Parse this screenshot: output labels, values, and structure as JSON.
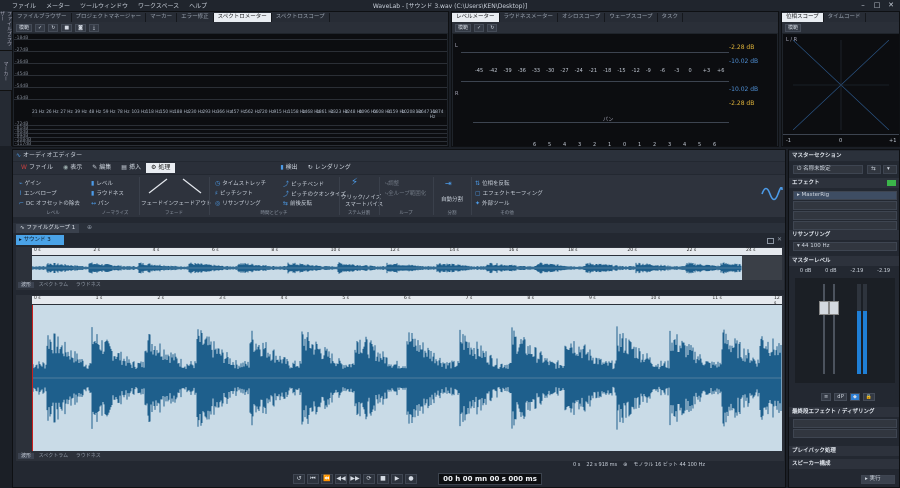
{
  "menubar": {
    "items": [
      "ファイル",
      "メーター",
      "ツールウィンドウ",
      "ワークスペース",
      "ヘルプ"
    ],
    "title": "WaveLab - [サウンド 3.wav (C:\\Users\\KEN\\Desktop)]",
    "controls": [
      "–",
      "□",
      "✕"
    ]
  },
  "left_tabs": [
    "ファイルブラウザー",
    "マーカー"
  ],
  "top_tabs": [
    "ファイルブラウザー",
    "プロジェクトマネージャー",
    "マーカー",
    "エラー修正",
    "スペクトロメーター",
    "スペクトロスコープ"
  ],
  "spectrum": {
    "mode_label": "模範",
    "y_labels": [
      "-18dB",
      "-27dB",
      "-36dB",
      "-45dB",
      "-54dB",
      "-63dB",
      "-72dB",
      "-81dB",
      "-90dB",
      "-99dB",
      "-108dB",
      "-117dB"
    ],
    "x_labels": [
      "21 Hz",
      "26 Hz",
      "27 Hz",
      "39 Hz",
      "48 Hz",
      "59 Hz",
      "78 Hz",
      "103 Hz",
      "118 Hz",
      "150 Hz",
      "188 Hz",
      "230 Hz",
      "293 Hz",
      "366 Hz",
      "457 Hz",
      "562 Hz",
      "720 Hz",
      "915 Hz",
      "1158 Hz",
      "1468 Hz",
      "1861 Hz",
      "2323 Hz",
      "3248 Hz",
      "4096 Hz",
      "6608 Hz",
      "8159 Hz",
      "10208 Hz",
      "12647 Hz",
      "15874 Hz"
    ]
  },
  "level_tabs": [
    "レベルメーター",
    "ラウドネスメーター",
    "オシロスコープ",
    "ウェーブスコープ",
    "タスク"
  ],
  "level_meter": {
    "mode_label": "模範",
    "l_label": "L",
    "r_label": "R",
    "peak_l": "-2.28 dB",
    "rms_l": "-10.02 dB",
    "rms_r": "-10.02 dB",
    "peak_r": "-2.28 dB",
    "scale": [
      "-45",
      "-42",
      "-39",
      "-36",
      "-33",
      "-30",
      "-27",
      "-24",
      "-21",
      "-18",
      "-15",
      "-12",
      "-9",
      "-6",
      "-3",
      "0",
      "+3",
      "+6"
    ],
    "pan_label": "パン",
    "pan_scale": [
      "6",
      "5",
      "4",
      "3",
      "2",
      "1",
      "0",
      "1",
      "2",
      "3",
      "4",
      "5",
      "6"
    ]
  },
  "phase_tabs": [
    "位相スコープ",
    "タイムコード"
  ],
  "phase": {
    "mode_label": "模範",
    "lr_label": "L / R",
    "scale": [
      "-1",
      "0",
      "+1"
    ]
  },
  "audio_editor": {
    "title": "オーディオエディター",
    "ribbon_tabs": [
      "ファイル",
      "表示",
      "編集",
      "挿入",
      "処理",
      "検出",
      "レンダリング"
    ],
    "groups": {
      "level": [
        "ゲイン",
        "エンベロープ",
        "DC オフセットの除去",
        "レベル",
        "ラウドネス",
        "パン"
      ],
      "fade": [
        "フェードイン",
        "フェードアウト"
      ],
      "pitch": [
        "タイムストレッチ",
        "ピッチシフト",
        "リサンプリング",
        "ピッチベンド",
        "ピッチのクオンタイズ",
        "前後反転"
      ],
      "noise": [
        "クリック/ノイズ",
        "スマートバイス"
      ],
      "loop": [
        "調整",
        "全ループ範囲化"
      ],
      "split": [
        "自動分割"
      ],
      "other": [
        "位相を反転",
        "エフェクトモーフィング",
        "外部ツール"
      ]
    },
    "group_labels": [
      "レベル",
      "ノーマライズ",
      "フェード",
      "時間とピッチ",
      "ステム分割",
      "ループ",
      "分割",
      "その他"
    ],
    "file_group": "ファイルグループ 1",
    "file_tab": "サウンド 3",
    "overview_ruler": [
      "0 s",
      "2 s",
      "4 s",
      "6 s",
      "8 s",
      "10 s",
      "12 s",
      "14 s",
      "16 s",
      "18 s",
      "20 s",
      "22 s",
      "24 s"
    ],
    "main_ruler": [
      "0 s",
      "1 s",
      "2 s",
      "3 s",
      "4 s",
      "5 s",
      "6 s",
      "7 s",
      "8 s",
      "9 s",
      "10 s",
      "11 s",
      "12 s"
    ],
    "view_tabs": [
      "波形",
      "スペクトラム",
      "ラウドネス"
    ],
    "status": {
      "time": "0 s",
      "zoom": "22 s 918 ms",
      "format": "モノラル 16 ビット 44 100 Hz"
    }
  },
  "transport": {
    "time": "00 h 00 mn 00 s 000 ms"
  },
  "master": {
    "title": "マスターセクション",
    "preset": "名称未設定",
    "effects_title": "エフェクト",
    "plugin": "MasterRig",
    "resampling_title": "リサンプリング",
    "resample_value": "44 100 Hz",
    "level_title": "マスターレベル",
    "level_values": [
      "0 dB",
      "0 dB",
      "-2.19",
      "-2.19"
    ],
    "final_title": "最終段エフェクト / ディザリング",
    "playback_title": "プレイバック処理",
    "speaker_title": "スピーカー構成",
    "render_label": "実行"
  }
}
